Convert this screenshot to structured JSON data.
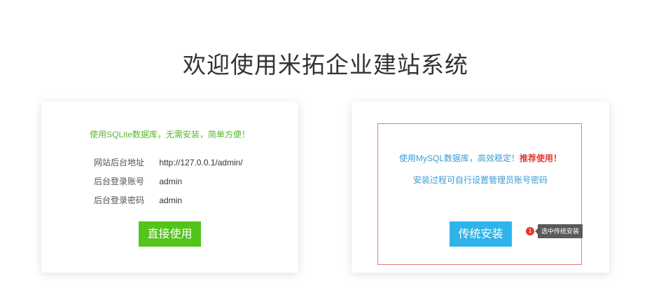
{
  "title": "欢迎使用米拓企业建站系统",
  "sqlite_card": {
    "tagline": "使用SQLite数据库，无需安装，简单方便！",
    "rows": [
      {
        "label": "网站后台地址",
        "value": "http://127.0.0.1/admin/"
      },
      {
        "label": "后台登录账号",
        "value": "admin"
      },
      {
        "label": "后台登录密码",
        "value": "admin"
      }
    ],
    "button_label": "直接使用"
  },
  "mysql_card": {
    "line1_text": "使用MySQL数据库，高效稳定！",
    "line1_recommend": "推荐使用！",
    "line2": "安装过程可自行设置管理员账号密码",
    "button_label": "传统安装",
    "badge_number": "1",
    "tooltip": "选中传统安装"
  },
  "colors": {
    "sqlite_green": "#5ab52c",
    "direct_button": "#52c41a",
    "mysql_blue": "#3a9bd6",
    "traditional_button": "#2fb4ea",
    "recommend_red": "#e8352b",
    "highlight_border": "#e9767a"
  }
}
